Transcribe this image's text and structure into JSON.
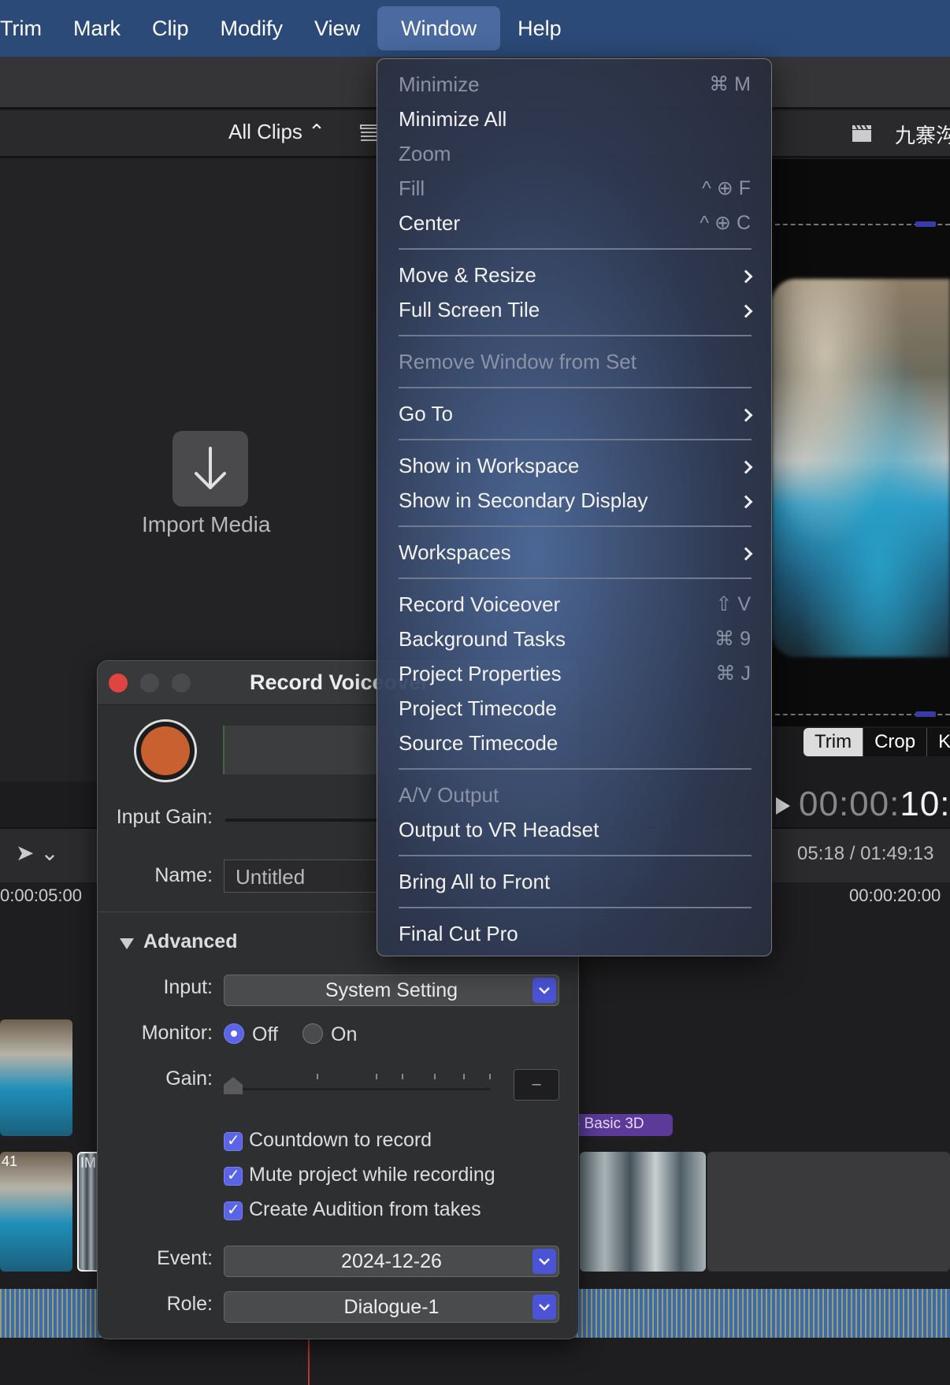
{
  "menubar": {
    "items": [
      "Trim",
      "Mark",
      "Clip",
      "Modify",
      "View",
      "Window",
      "Help"
    ],
    "active": "Window"
  },
  "browser": {
    "filter_label": "All Clips ⌃",
    "import_label": "Import Media",
    "project_title": "九寨沟"
  },
  "viewer": {
    "buttons": [
      "Trim",
      "Crop",
      "K"
    ],
    "selected_button": "Trim",
    "timecode_dim": "00:00:",
    "timecode_bright": "10:",
    "duration": "05:18 / 01:49:13"
  },
  "timeline": {
    "ruler_left": "0:00:05:00",
    "ruler_right": "00:00:20:00",
    "clip_label_1": "41",
    "clip_label_2": "IM",
    "effect_label": "Basic 3D"
  },
  "voiceover": {
    "title": "Record Voiceover",
    "input_gain_label": "Input Gain:",
    "name_label": "Name:",
    "name_value": "Untitled",
    "advanced_label": "Advanced",
    "input_label": "Input:",
    "input_value": "System Setting",
    "monitor_label": "Monitor:",
    "monitor_off": "Off",
    "monitor_on": "On",
    "gain_label": "Gain:",
    "gain_value": "–",
    "checkboxes": [
      {
        "label": "Countdown to record",
        "checked": true
      },
      {
        "label": "Mute project while recording",
        "checked": true
      },
      {
        "label": "Create Audition from takes",
        "checked": true
      }
    ],
    "event_label": "Event:",
    "event_value": "2024-12-26",
    "role_label": "Role:",
    "role_value": "Dialogue-1"
  },
  "window_menu": {
    "items": [
      {
        "label": "Minimize",
        "shortcut": "⌘ M",
        "enabled": false
      },
      {
        "label": "Minimize All",
        "shortcut": "",
        "enabled": true
      },
      {
        "label": "Zoom",
        "shortcut": "",
        "enabled": false
      },
      {
        "label": "Fill",
        "shortcut": "^ ⊕ F",
        "enabled": false
      },
      {
        "label": "Center",
        "shortcut": "^ ⊕ C",
        "enabled": true
      },
      {
        "label": "Move & Resize",
        "submenu": true,
        "enabled": true
      },
      {
        "label": "Full Screen Tile",
        "submenu": true,
        "enabled": true
      },
      {
        "label": "Remove Window from Set",
        "enabled": false
      },
      {
        "label": "Go To",
        "submenu": true,
        "enabled": true
      },
      {
        "label": "Show in Workspace",
        "submenu": true,
        "enabled": true
      },
      {
        "label": "Show in Secondary Display",
        "submenu": true,
        "enabled": true
      },
      {
        "label": "Workspaces",
        "submenu": true,
        "enabled": true
      },
      {
        "label": "Record Voiceover",
        "shortcut": "⇧ V",
        "enabled": true
      },
      {
        "label": "Background Tasks",
        "shortcut": "⌘ 9",
        "enabled": true
      },
      {
        "label": "Project Properties",
        "shortcut": "⌘ J",
        "enabled": true
      },
      {
        "label": "Project Timecode",
        "enabled": true
      },
      {
        "label": "Source Timecode",
        "enabled": true
      },
      {
        "label": "A/V Output",
        "enabled": false
      },
      {
        "label": "Output to VR Headset",
        "enabled": true
      },
      {
        "label": "Bring All to Front",
        "enabled": true
      },
      {
        "label": "Final Cut Pro",
        "enabled": true
      }
    ]
  },
  "colors": {
    "menubar": "#2b4a78",
    "accent": "#5b63e6",
    "record": "#c9602f",
    "close": "#e0443e"
  }
}
